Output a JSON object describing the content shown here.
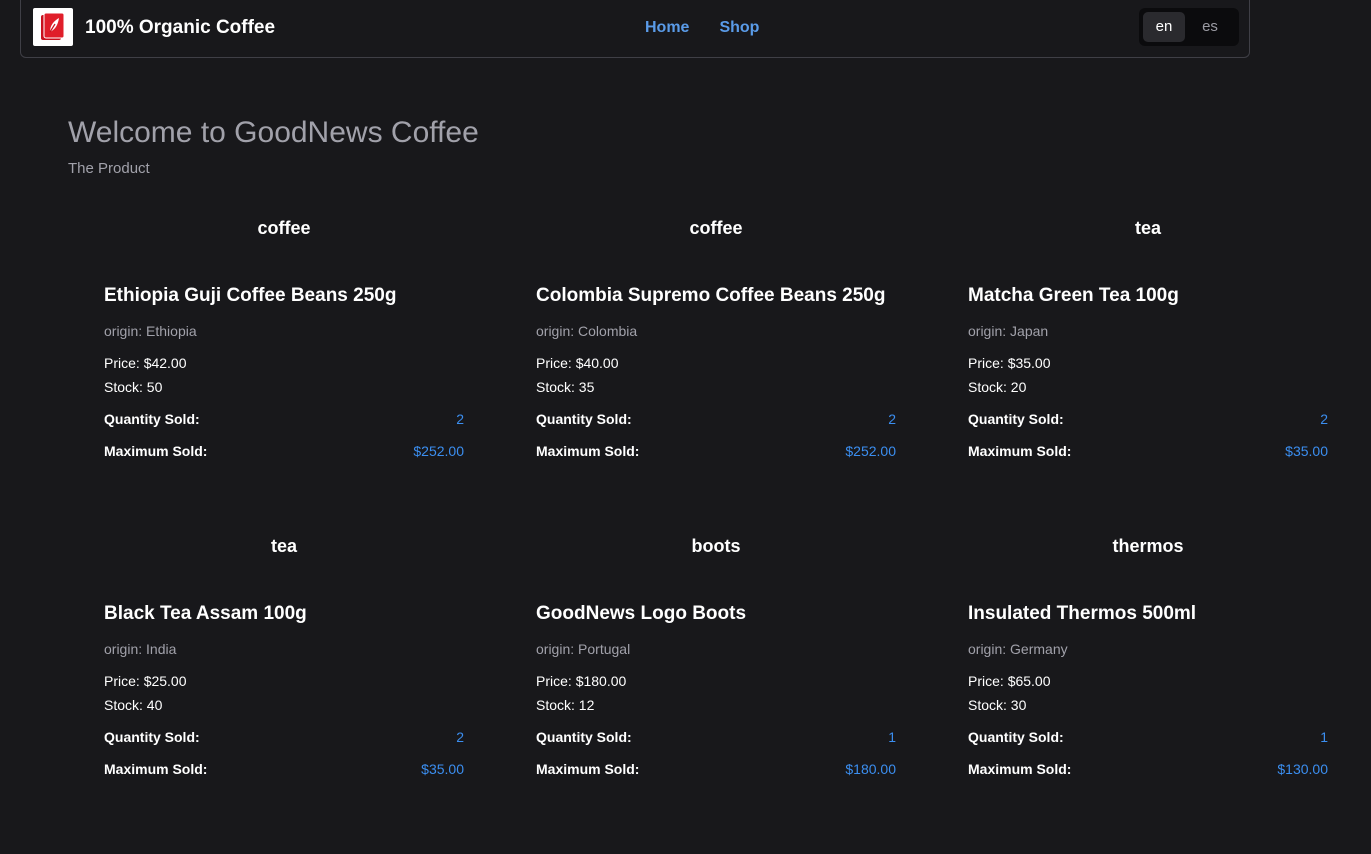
{
  "nav": {
    "brand": "100% Organic Coffee",
    "logo_icon": "book-logo-icon",
    "links": [
      "Home",
      "Shop"
    ],
    "languages": [
      "en",
      "es"
    ],
    "active_language": "en"
  },
  "main": {
    "title": "Welcome to GoodNews Coffee",
    "subtitle": "The Product"
  },
  "labels": {
    "origin_prefix": "origin: ",
    "price_prefix": "Price: ",
    "stock_prefix": "Stock: ",
    "quantity_sold": "Quantity Sold:",
    "maximum_sold": "Maximum Sold:"
  },
  "products": [
    {
      "category": "coffee",
      "name": "Ethiopia Guji Coffee Beans 250g",
      "origin": "Ethiopia",
      "price": "$42.00",
      "stock": "50",
      "quantity_sold": "2",
      "maximum_sold": "$252.00"
    },
    {
      "category": "coffee",
      "name": "Colombia Supremo Coffee Beans 250g",
      "origin": "Colombia",
      "price": "$40.00",
      "stock": "35",
      "quantity_sold": "2",
      "maximum_sold": "$252.00"
    },
    {
      "category": "tea",
      "name": "Matcha Green Tea 100g",
      "origin": "Japan",
      "price": "$35.00",
      "stock": "20",
      "quantity_sold": "2",
      "maximum_sold": "$35.00"
    },
    {
      "category": "tea",
      "name": "Black Tea Assam 100g",
      "origin": "India",
      "price": "$25.00",
      "stock": "40",
      "quantity_sold": "2",
      "maximum_sold": "$35.00"
    },
    {
      "category": "boots",
      "name": "GoodNews Logo Boots",
      "origin": "Portugal",
      "price": "$180.00",
      "stock": "12",
      "quantity_sold": "1",
      "maximum_sold": "$180.00"
    },
    {
      "category": "thermos",
      "name": "Insulated Thermos 500ml",
      "origin": "Germany",
      "price": "$65.00",
      "stock": "30",
      "quantity_sold": "1",
      "maximum_sold": "$130.00"
    }
  ],
  "colors": {
    "background": "#18181b",
    "link": "#5a9be8",
    "accent_value": "#3b8ef0",
    "logo_red": "#c8101e"
  }
}
